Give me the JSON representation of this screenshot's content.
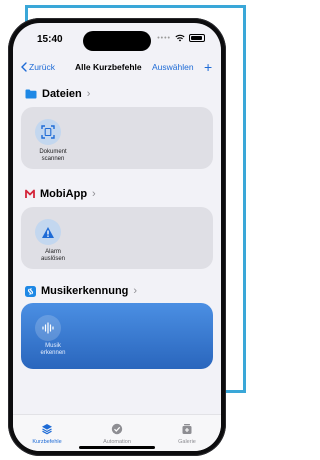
{
  "status_bar": {
    "time": "15:40"
  },
  "navbar": {
    "back_label": "Zurück",
    "title": "Alle Kurzbefehle",
    "edit_label": "Auswählen",
    "add_label": "+"
  },
  "sections": [
    {
      "title": "Dateien",
      "tile_label_line1": "Dokument",
      "tile_label_line2": "scannen"
    },
    {
      "title": "MobiApp",
      "tile_label_line1": "Alarm",
      "tile_label_line2": "auslösen"
    },
    {
      "title": "Musikerkennung",
      "tile_label_line1": "Musik",
      "tile_label_line2": "erkennen"
    }
  ],
  "tabbar": {
    "items": [
      {
        "label": "Kurzbefehle"
      },
      {
        "label": "Automation"
      },
      {
        "label": "Galerie"
      }
    ]
  },
  "colors": {
    "accent": "#1e6bd6",
    "outline": "#3aa7d8",
    "music_card": "#3a7ad0"
  }
}
